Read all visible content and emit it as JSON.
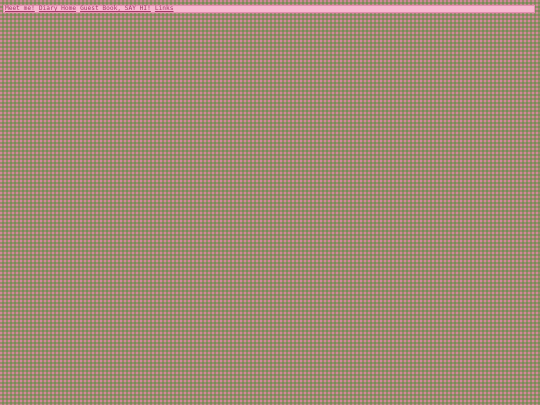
{
  "nav": {
    "links": [
      {
        "label": "Meet me!"
      },
      {
        "label": "Diary Home"
      },
      {
        "label": "Guest Book, SAY HI!"
      },
      {
        "label": "Links"
      }
    ]
  },
  "colors": {
    "nav_background": "#f7b7cf",
    "link_color": "#a23a66",
    "page_pattern_base": "#9c8a6a"
  }
}
